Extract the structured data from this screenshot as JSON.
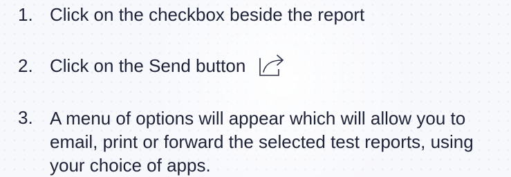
{
  "steps": [
    {
      "number": "1.",
      "text": "Click on the checkbox beside the report"
    },
    {
      "number": "2.",
      "text": "Click on the Send button",
      "icon": "send-share-icon"
    },
    {
      "number": "3.",
      "text": "A menu of options will appear which will allow you to email, print or forward the selected test reports, using your choice of apps."
    }
  ]
}
